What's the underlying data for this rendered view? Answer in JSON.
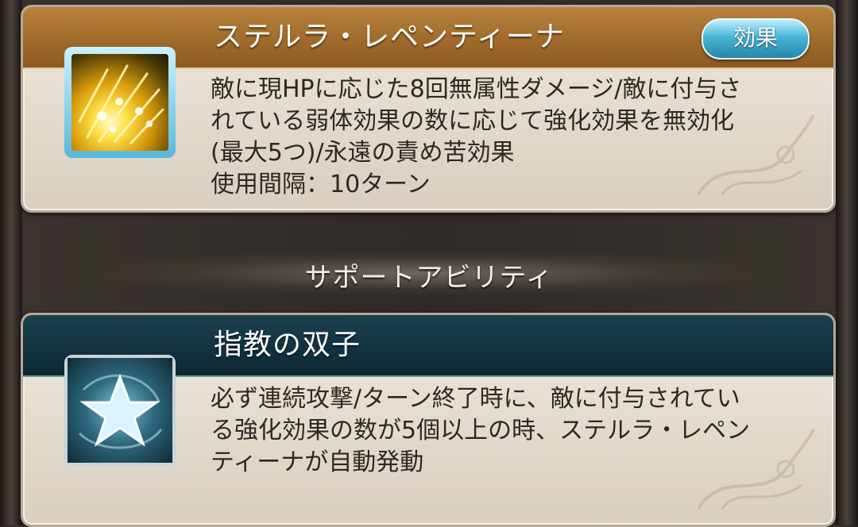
{
  "skill": {
    "title": "ステルラ・レペンティーナ",
    "effect_button": "効果",
    "description_lines": [
      "敵に現HPに応じた8回無属性ダメージ/敵に付与さ",
      "れている弱体効果の数に応じて強化効果を無効化",
      "(最大5つ)/永遠の責め苦効果",
      "使用間隔：10ターン"
    ],
    "icon": "lightning-burst-icon"
  },
  "section": {
    "title": "サポートアビリティ"
  },
  "support": {
    "title": "指教の双子",
    "description_lines": [
      "必ず連続攻撃/ターン終了時に、敵に付与されてい",
      "る強化効果の数が5個以上の時、ステルラ・レペン",
      "ティーナが自動発動"
    ],
    "icon": "star-icon"
  },
  "colors": {
    "skill_header": "#a06a2b",
    "support_header": "#123341",
    "effect_button": "#4ab4d6",
    "card_bg": "#e2d9cb"
  }
}
